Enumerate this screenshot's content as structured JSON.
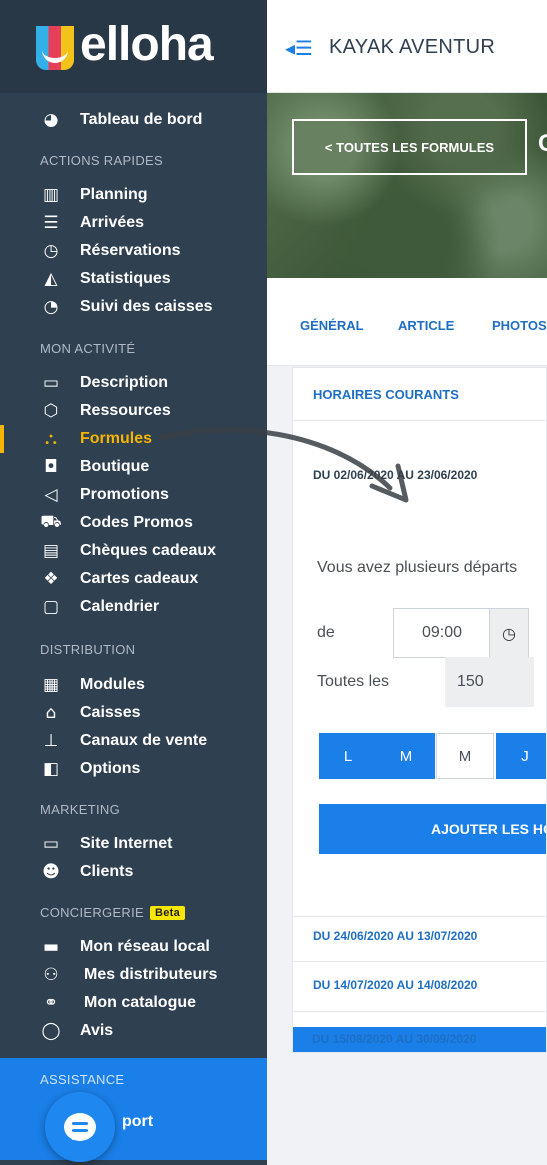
{
  "brand": {
    "name": "elloha"
  },
  "sidebar": {
    "dashboard": "Tableau de bord",
    "sections": {
      "quick_actions": "ACTIONS RAPIDES",
      "activity": "MON ACTIVITÉ",
      "distribution": "DISTRIBUTION",
      "marketing": "MARKETING",
      "concierge": "CONCIERGERIE",
      "concierge_badge": "Beta",
      "assistance": "ASSISTANCE"
    },
    "quick_items": [
      "Planning",
      "Arrivées",
      "Réservations",
      "Statistiques",
      "Suivi des caisses"
    ],
    "activity_items": [
      "Description",
      "Ressources",
      "Formules",
      "Boutique",
      "Promotions",
      "Codes Promos",
      "Chèques cadeaux",
      "Cartes cadeaux",
      "Calendrier"
    ],
    "distribution_items": [
      "Modules",
      "Caisses",
      "Canaux de vente",
      "Options"
    ],
    "marketing_items": [
      "Site Internet",
      "Clients"
    ],
    "concierge_items": [
      "Mon réseau local",
      "Mes distributeurs",
      "Mon catalogue",
      "Avis"
    ],
    "support_partial": "port",
    "active_item": "Formules",
    "accent_color": "#f4b400"
  },
  "header": {
    "title": "KAYAK AVENTUR"
  },
  "hero": {
    "back_button": "< TOUTES LES FORMULES"
  },
  "tabs": [
    "GÉNÉRAL",
    "ARTICLE",
    "PHOTOS"
  ],
  "schedule": {
    "section_title": "HORAIRES COURANTS",
    "current_period": "DU 02/06/2020 AU 23/06/2020",
    "question": "Vous avez plusieurs départs",
    "from_label": "de",
    "from_time": "09:00",
    "every_label": "Toutes les",
    "interval_value": "150",
    "days": [
      {
        "label": "L",
        "selected": true
      },
      {
        "label": "M",
        "selected": true
      },
      {
        "label": "M",
        "selected": false
      },
      {
        "label": "J",
        "selected": true
      }
    ],
    "add_button": "AJOUTER LES HO",
    "other_periods": [
      "DU 24/06/2020 AU 13/07/2020",
      "DU 14/07/2020 AU 14/08/2020",
      "DU 15/08/2020 AU 30/09/2020"
    ]
  },
  "colors": {
    "sidebar_bg": "#2f4050",
    "primary": "#1a7fe8",
    "link": "#1e6fc4"
  }
}
